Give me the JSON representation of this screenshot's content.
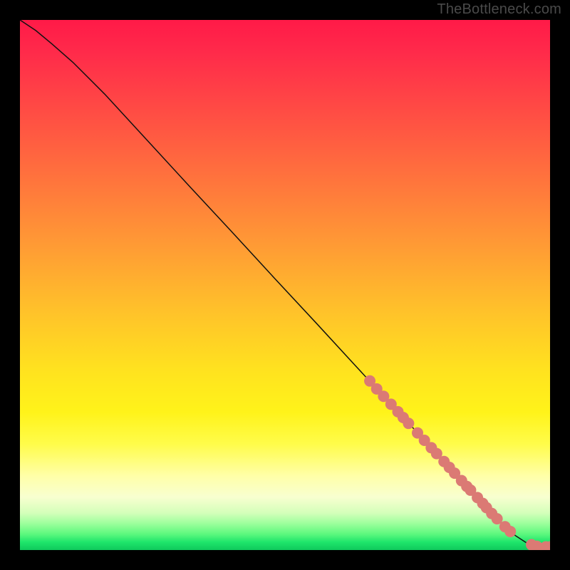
{
  "attribution": "TheBottleneck.com",
  "chart_data": {
    "type": "line",
    "title": "",
    "xlabel": "",
    "ylabel": "",
    "x_range": [
      0,
      100
    ],
    "y_range": [
      0,
      100
    ],
    "series": [
      {
        "name": "curve",
        "x": [
          0,
          3,
          6,
          10,
          16,
          24,
          32,
          40,
          48,
          56,
          64,
          70,
          74,
          78,
          82,
          86,
          89,
          91.5,
          93.5,
          95.5,
          97.5,
          100
        ],
        "y": [
          100,
          98,
          95.5,
          92,
          86,
          77.3,
          68.6,
          60,
          51.3,
          42.7,
          34,
          27.5,
          23.2,
          18.8,
          14.5,
          10.2,
          6.9,
          4.4,
          2.7,
          1.4,
          0.7,
          0.6
        ]
      }
    ],
    "markers": {
      "name": "points",
      "color": "#db7a74",
      "x": [
        66,
        67.3,
        68.6,
        70,
        71.3,
        72.3,
        73.3,
        75,
        76.3,
        77.6,
        78.6,
        80,
        81,
        82,
        83.3,
        84.3,
        85,
        86.3,
        87.3,
        88,
        89,
        90,
        91.5,
        92.5,
        96.5,
        97.5,
        99.2,
        100
      ],
      "y": [
        31.9,
        30.4,
        29,
        27.5,
        26.1,
        25,
        23.9,
        22.1,
        20.7,
        19.3,
        18.2,
        16.7,
        15.6,
        14.5,
        13.1,
        12,
        11.3,
        9.9,
        8.8,
        8,
        6.9,
        5.9,
        4.4,
        3.5,
        1,
        0.7,
        0.6,
        0.6
      ],
      "radius": 8
    }
  }
}
